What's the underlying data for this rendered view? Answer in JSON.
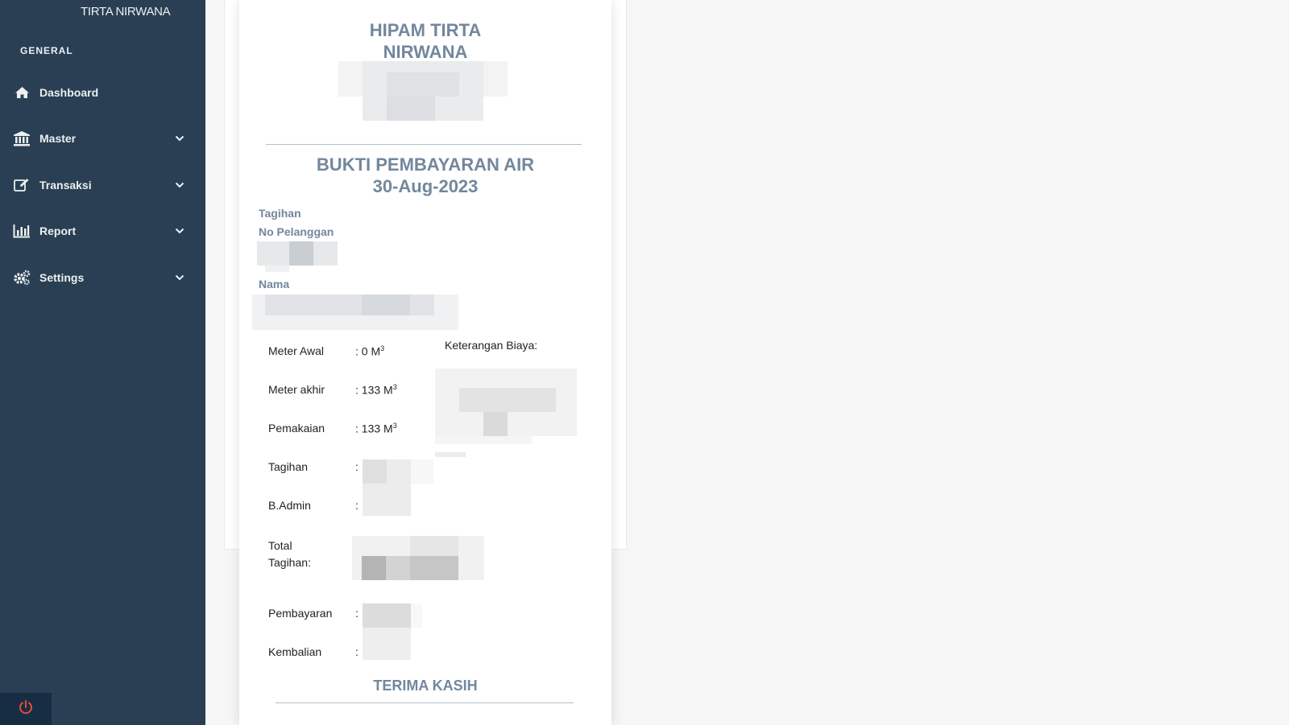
{
  "sidebar": {
    "brand": "TIRTA NIRWANA",
    "section_title": "GENERAL",
    "items": [
      {
        "label": "Dashboard",
        "icon": "home-icon",
        "has_submenu": false
      },
      {
        "label": "Master",
        "icon": "bank-icon",
        "has_submenu": true
      },
      {
        "label": "Transaksi",
        "icon": "edit-icon",
        "has_submenu": true
      },
      {
        "label": "Report",
        "icon": "bar-chart-icon",
        "has_submenu": true
      },
      {
        "label": "Settings",
        "icon": "gears-icon",
        "has_submenu": true
      }
    ],
    "logout_icon": "power-icon"
  },
  "receipt": {
    "org_name_line1": "HIPAM TIRTA",
    "org_name_line2": "NIRWANA",
    "title_line1": "BUKTI PEMBAYARAN AIR",
    "title_line2": "30-Aug-2023",
    "tagihan_label": "Tagihan",
    "no_pelanggan_label": "No Pelanggan",
    "nama_label": "Nama",
    "rows": [
      {
        "label": "Meter Awal",
        "prefix": ": 0 M",
        "sup": "3"
      },
      {
        "label": "Meter akhir",
        "prefix": ": 133 M",
        "sup": "3"
      },
      {
        "label": "Pemakaian",
        "prefix": ": 133 M",
        "sup": "3"
      },
      {
        "label": "Tagihan",
        "prefix": ":",
        "sup": ""
      },
      {
        "label": "B.Admin",
        "prefix": ":",
        "sup": ""
      },
      {
        "label": "Total Tagihan:",
        "prefix": "",
        "sup": ""
      },
      {
        "label": "Pembayaran",
        "prefix": ":",
        "sup": ""
      },
      {
        "label": "Kembalian",
        "prefix": ":",
        "sup": ""
      }
    ],
    "keterangan_label": "Keterangan Biaya:",
    "footer": "TERIMA KASIH"
  }
}
